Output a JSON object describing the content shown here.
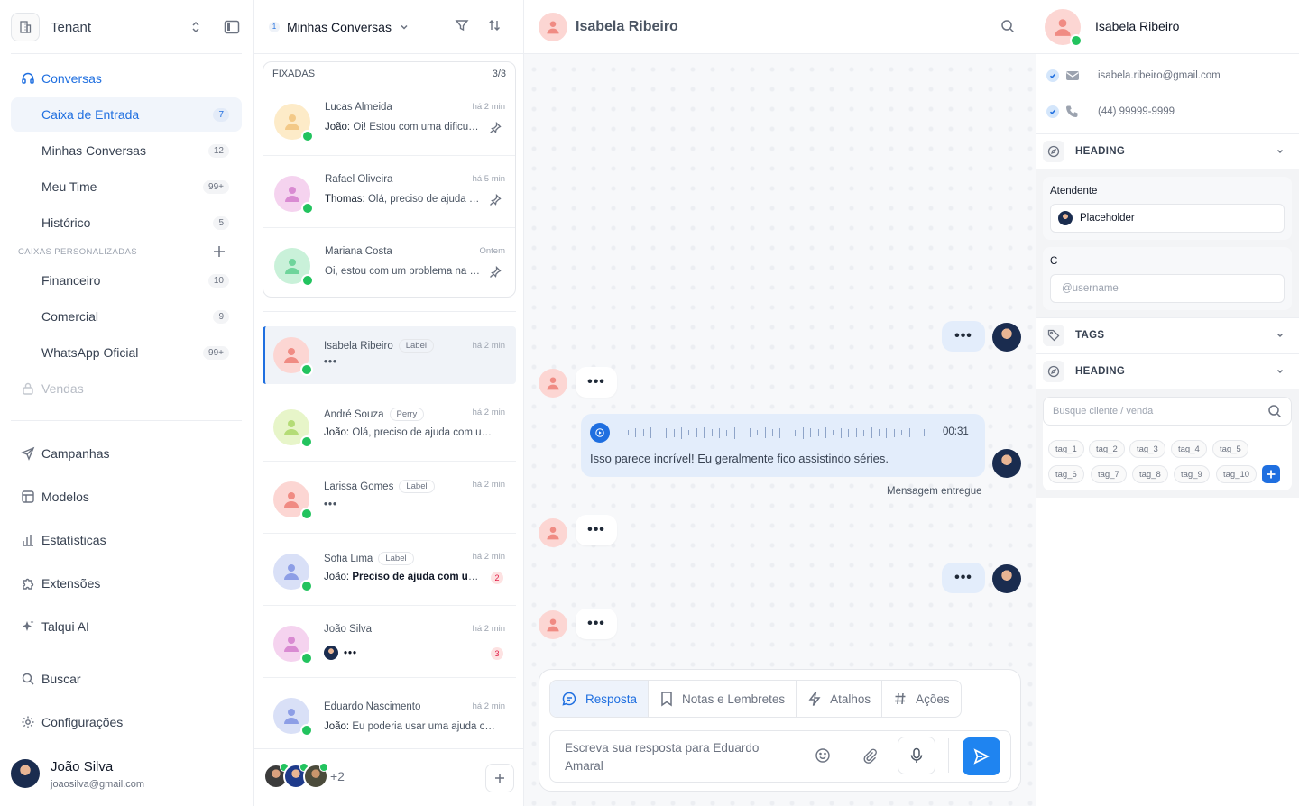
{
  "sidebar": {
    "tenant_name": "Tenant",
    "nav": {
      "conversas": "Conversas",
      "caixa_entrada": {
        "label": "Caixa de Entrada",
        "count": "7"
      },
      "minhas_conversas": {
        "label": "Minhas Conversas",
        "count": "12"
      },
      "meu_time": {
        "label": "Meu Time",
        "count": "99+"
      },
      "historico": {
        "label": "Histórico",
        "count": "5"
      }
    },
    "custom_section_label": "CAIXAS PERSONALIZADAS",
    "custom": {
      "financeiro": {
        "label": "Financeiro",
        "count": "10"
      },
      "comercial": {
        "label": "Comercial",
        "count": "9"
      },
      "whatsapp": {
        "label": "WhatsApp Oficial",
        "count": "99+"
      },
      "vendas": {
        "label": "Vendas"
      }
    },
    "menu": {
      "campanhas": "Campanhas",
      "modelos": "Modelos",
      "estatisticas": "Estatísticas",
      "extensoes": "Extensões",
      "talqui_ai": "Talqui AI",
      "buscar": "Buscar",
      "configuracoes": "Configurações"
    },
    "user": {
      "name": "João Silva",
      "email": "joaosilva@gmail.com"
    }
  },
  "conv_list": {
    "badge": "1",
    "title": "Minhas Conversas",
    "pinned_label": "FIXADAS",
    "pinned_count": "3/3",
    "pinned": [
      {
        "name": "Lucas Almeida",
        "time": "há 2 min",
        "sender": "João:",
        "preview": "Oi! Estou com uma dificuldade"
      },
      {
        "name": "Rafael Oliveira",
        "time": "há 5 min",
        "sender": "Thomas:",
        "preview": "Olá, preciso de ajuda com"
      },
      {
        "name": "Mariana Costa",
        "time": "Ontem",
        "preview": "Oi, estou com um problema na minha conta"
      }
    ],
    "items": [
      {
        "name": "Isabela Ribeiro",
        "label": "Label",
        "time": "há 2 min",
        "preview": "•••"
      },
      {
        "name": "André Souza",
        "label": "Perry",
        "time": "há 2 min",
        "sender": "João:",
        "preview": "Olá, preciso de ajuda com um pedido"
      },
      {
        "name": "Larissa Gomes",
        "label": "Label",
        "time": "há 2 min",
        "preview": "•••"
      },
      {
        "name": "Sofia Lima",
        "label": "Label",
        "time": "há 2 min",
        "sender": "João:",
        "preview": "Preciso de ajuda com um pedido",
        "unread": "2"
      },
      {
        "name": "João Silva",
        "time": "há 2 min",
        "preview": "•••",
        "unread": "3"
      },
      {
        "name": "Eduardo Nascimento",
        "time": "há 2 min",
        "sender": "João:",
        "preview": "Eu poderia usar uma ajuda com isso"
      }
    ],
    "agents_more": "+2"
  },
  "chat": {
    "contact_name": "Isabela Ribeiro",
    "typing": "•••",
    "audio": {
      "duration": "00:31",
      "transcript": "Isso parece incrível! Eu geralmente fico assistindo séries."
    },
    "delivered": "Mensagem entregue",
    "composer": {
      "tabs": [
        "Resposta",
        "Notas e Lembretes",
        "Atalhos",
        "Ações"
      ],
      "placeholder": "Escreva sua resposta para Eduardo Amaral"
    }
  },
  "details": {
    "name": "Isabela Ribeiro",
    "email": "isabela.ribeiro@gmail.com",
    "phone": "(44) 99999-9999",
    "heading_1": "HEADING",
    "attendant_label": "Atendente",
    "attendant_value": "Placeholder",
    "c_label": "C",
    "c_placeholder": "@username",
    "tags_label": "TAGS",
    "heading_2": "HEADING",
    "search_placeholder": "Busque cliente / venda",
    "tags": [
      "tag_1",
      "tag_2",
      "tag_3",
      "tag_4",
      "tag_5",
      "tag_6",
      "tag_7",
      "tag_8",
      "tag_9",
      "tag_10"
    ]
  },
  "colors": {
    "accent": "#1f6fe0",
    "whatsapp": "#22c35e",
    "outgoing_bubble": "#e3edfb",
    "send_button": "#1f84f0"
  }
}
